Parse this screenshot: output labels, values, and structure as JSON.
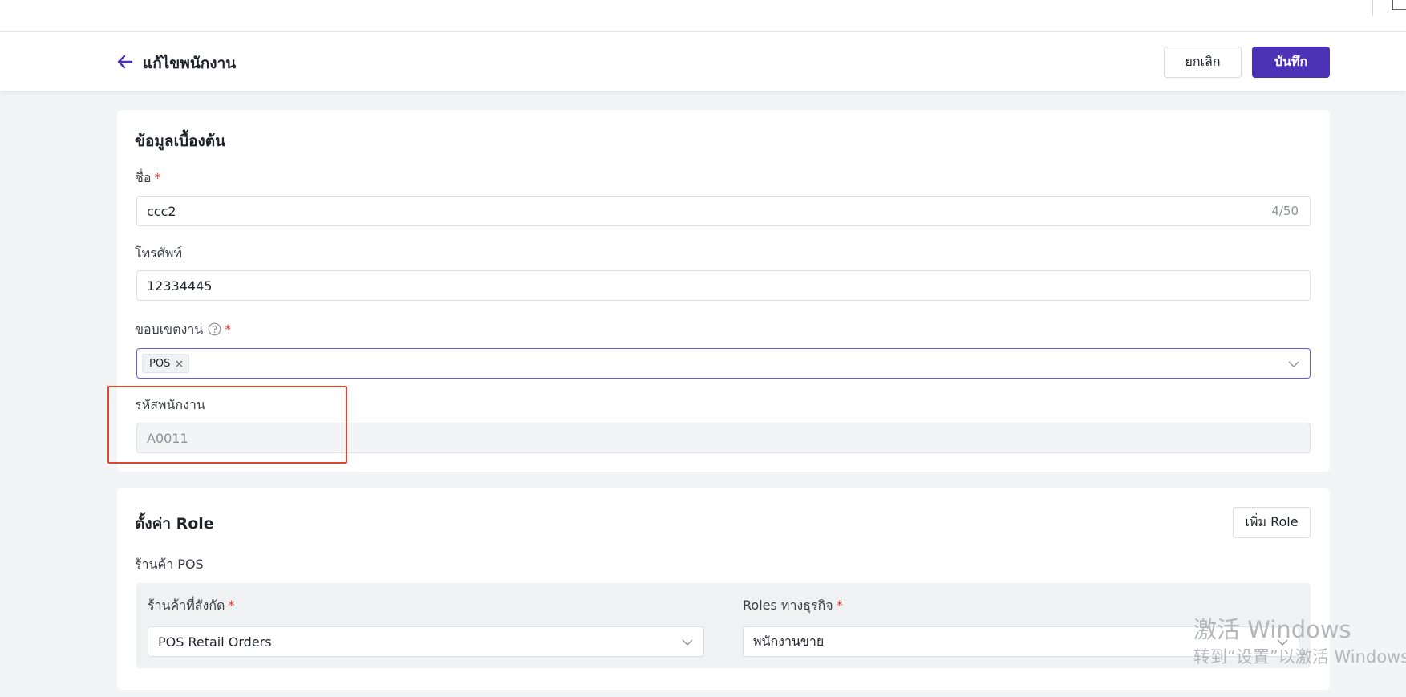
{
  "header": {
    "title": "แก้ไขพนักงาน",
    "cancel_label": "ยกเลิก",
    "save_label": "บันทึก"
  },
  "basic_info": {
    "section_title": "ข้อมูลเบื้องต้น",
    "name": {
      "label": "ชื่อ",
      "required_mark": "*",
      "value": "ccc2",
      "counter": "4/50"
    },
    "phone": {
      "label": "โทรศัพท์",
      "value": "12334445"
    },
    "scope": {
      "label": "ขอบเขตงาน",
      "required_mark": "*",
      "tags": [
        "POS"
      ]
    },
    "employee_code": {
      "label": "รหัสพนักงาน",
      "value": "A0011"
    }
  },
  "role_settings": {
    "section_title": "ตั้งค่า Role",
    "add_role_label": "เพิ่ม Role",
    "group_label": "ร้านค้า POS",
    "store": {
      "label": "ร้านค้าที่สังกัด",
      "required_mark": "*",
      "value": "POS Retail Orders"
    },
    "business_role": {
      "label": "Roles ทางธุรกิจ",
      "required_mark": "*",
      "value": "พนักงานขาย"
    }
  },
  "watermark": {
    "line1": "激活 Windows",
    "line2": "转到“设置”以激活 Windows"
  },
  "colors": {
    "primary": "#4a31b5",
    "required": "#e53935",
    "highlight": "#e0442e"
  }
}
